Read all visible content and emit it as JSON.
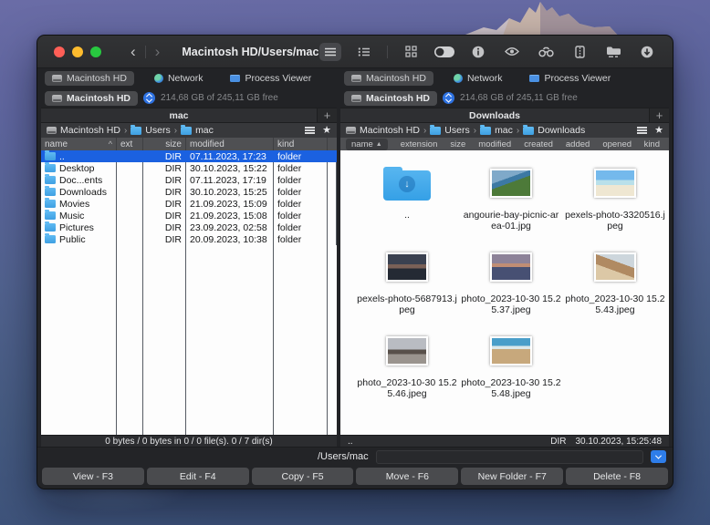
{
  "window": {
    "title": "Macintosh HD/Users/mac"
  },
  "toolbar": {
    "icons": [
      "list-view",
      "detail-view",
      "grid-view",
      "dual-pane-toggle",
      "info",
      "preview-eye",
      "search-binoculars",
      "archive-zip",
      "network-folder",
      "download"
    ]
  },
  "colors": {
    "selection_blue": "#1b61e0",
    "accent_blue": "#2e7de9",
    "folder_blue": "#45a8ea",
    "traffic_red": "#ff5f57",
    "traffic_yellow": "#febc2e",
    "traffic_green": "#28c840"
  },
  "panes": {
    "left": {
      "tabs": [
        {
          "label": "Macintosh HD"
        },
        {
          "label": "Network"
        },
        {
          "label": "Process Viewer"
        }
      ],
      "drive": {
        "name": "Macintosh HD",
        "free": "214,68 GB of 245,11 GB free"
      },
      "tab_title": "mac",
      "breadcrumb": [
        "Macintosh HD",
        "Users",
        "mac"
      ],
      "columns": [
        "name",
        "ext",
        "size",
        "modified",
        "kind"
      ],
      "sort_indicator": "^",
      "rows": [
        {
          "name": "..",
          "ext": "",
          "size": "DIR",
          "modified": "07.11.2023, 17:23",
          "kind": "folder"
        },
        {
          "name": "Desktop",
          "ext": "",
          "size": "DIR",
          "modified": "30.10.2023, 15:22",
          "kind": "folder"
        },
        {
          "name": "Doc...ents",
          "ext": "",
          "size": "DIR",
          "modified": "07.11.2023, 17:19",
          "kind": "folder"
        },
        {
          "name": "Downloads",
          "ext": "",
          "size": "DIR",
          "modified": "30.10.2023, 15:25",
          "kind": "folder"
        },
        {
          "name": "Movies",
          "ext": "",
          "size": "DIR",
          "modified": "21.09.2023, 15:09",
          "kind": "folder"
        },
        {
          "name": "Music",
          "ext": "",
          "size": "DIR",
          "modified": "21.09.2023, 15:08",
          "kind": "folder"
        },
        {
          "name": "Pictures",
          "ext": "",
          "size": "DIR",
          "modified": "23.09.2023, 02:58",
          "kind": "folder"
        },
        {
          "name": "Public",
          "ext": "",
          "size": "DIR",
          "modified": "20.09.2023, 10:38",
          "kind": "folder"
        }
      ],
      "status": "0 bytes / 0 bytes in 0 / 0 file(s). 0 / 7 dir(s)"
    },
    "right": {
      "tabs": [
        {
          "label": "Macintosh HD"
        },
        {
          "label": "Network"
        },
        {
          "label": "Process Viewer"
        }
      ],
      "drive": {
        "name": "Macintosh HD",
        "free": "214,68 GB of 245,11 GB free"
      },
      "tab_title": "Downloads",
      "breadcrumb": [
        "Macintosh HD",
        "Users",
        "mac",
        "Downloads"
      ],
      "columns": [
        "name",
        "extension",
        "size",
        "modified",
        "created",
        "added",
        "opened",
        "kind"
      ],
      "sort_indicator": "▲",
      "items": [
        {
          "label": "..",
          "type": "folder"
        },
        {
          "label": "angourie-bay-picnic-area-01.jpg",
          "type": "image"
        },
        {
          "label": "pexels-photo-3320516.jpeg",
          "type": "image"
        },
        {
          "label": "pexels-photo-5687913.jpeg",
          "type": "image"
        },
        {
          "label": "photo_2023-10-30 15.25.37.jpeg",
          "type": "image"
        },
        {
          "label": "photo_2023-10-30 15.25.43.jpeg",
          "type": "image"
        },
        {
          "label": "photo_2023-10-30 15.25.46.jpeg",
          "type": "image"
        },
        {
          "label": "photo_2023-10-30 15.25.48.jpeg",
          "type": "image"
        }
      ],
      "status": {
        "selection": "..",
        "kind": "DIR",
        "date": "30.10.2023, 15:25:48"
      }
    }
  },
  "command_bar": {
    "path": "/Users/mac"
  },
  "function_bar": {
    "buttons": [
      "View - F3",
      "Edit - F4",
      "Copy - F5",
      "Move - F6",
      "New Folder - F7",
      "Delete - F8"
    ]
  }
}
